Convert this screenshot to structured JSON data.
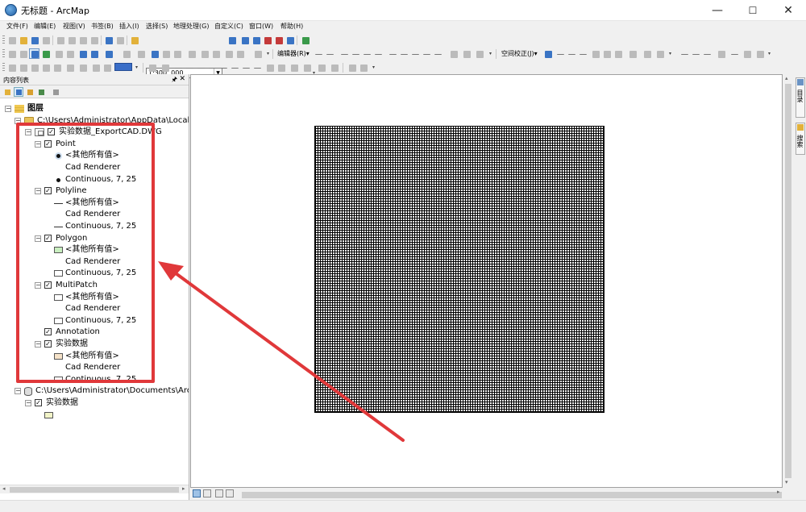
{
  "window": {
    "title": "无标题 - ArcMap",
    "minimize": "—",
    "maximize": "☐",
    "close": "✕"
  },
  "menu": [
    "文件(F)",
    "编辑(E)",
    "视图(V)",
    "书签(B)",
    "插入(I)",
    "选择(S)",
    "地理处理(G)",
    "自定义(C)",
    "窗口(W)",
    "帮助(H)"
  ],
  "toolbar": {
    "scale": "1:300, 000",
    "editor_label": "编辑器(R)▾",
    "spatial_adjust_label": "空间校正(J)▾"
  },
  "toc": {
    "title": "内容列表",
    "pin": "🖈",
    "close": "✕",
    "tree": [
      {
        "level": 0,
        "type": "layers",
        "expander": "⊟",
        "label": "图层"
      },
      {
        "level": 1,
        "type": "folder",
        "expander": "⊟",
        "label": "C:\\Users\\Administrator\\AppData\\Local\\Te"
      },
      {
        "level": 2,
        "type": "group",
        "expander": "⊟",
        "checkbox": true,
        "label": "实验数据_ExportCAD.DWG"
      },
      {
        "level": 3,
        "type": "layer",
        "expander": "⊟",
        "checkbox": true,
        "label": "Point"
      },
      {
        "level": 4,
        "type": "symbol",
        "symbol": "dot-ring",
        "label": "<其他所有值>"
      },
      {
        "level": 4,
        "type": "text",
        "label": "Cad Renderer"
      },
      {
        "level": 4,
        "type": "symbol",
        "symbol": "dot",
        "label": "Continuous, 7, 25"
      },
      {
        "level": 3,
        "type": "layer",
        "expander": "⊟",
        "checkbox": true,
        "label": "Polyline"
      },
      {
        "level": 4,
        "type": "symbol",
        "symbol": "line",
        "label": "<其他所有值>"
      },
      {
        "level": 4,
        "type": "text",
        "label": "Cad Renderer"
      },
      {
        "level": 4,
        "type": "symbol",
        "symbol": "line",
        "label": "Continuous, 7, 25"
      },
      {
        "level": 3,
        "type": "layer",
        "expander": "⊟",
        "checkbox": true,
        "label": "Polygon"
      },
      {
        "level": 4,
        "type": "symbol",
        "symbol": "rect-green",
        "label": "<其他所有值>"
      },
      {
        "level": 4,
        "type": "text",
        "label": "Cad Renderer"
      },
      {
        "level": 4,
        "type": "symbol",
        "symbol": "rect",
        "label": "Continuous, 7, 25"
      },
      {
        "level": 3,
        "type": "layer",
        "expander": "⊟",
        "checkbox": true,
        "label": "MultiPatch"
      },
      {
        "level": 4,
        "type": "symbol",
        "symbol": "rect",
        "label": "<其他所有值>"
      },
      {
        "level": 4,
        "type": "text",
        "label": "Cad Renderer"
      },
      {
        "level": 4,
        "type": "symbol",
        "symbol": "rect",
        "label": "Continuous, 7, 25"
      },
      {
        "level": 3,
        "type": "layer",
        "checkbox": true,
        "label": "Annotation"
      },
      {
        "level": 3,
        "type": "layer",
        "expander": "⊟",
        "checkbox": true,
        "label": "实验数据"
      },
      {
        "level": 4,
        "type": "symbol",
        "symbol": "rect-tan",
        "label": "<其他所有值>"
      },
      {
        "level": 4,
        "type": "text",
        "label": "Cad Renderer"
      },
      {
        "level": 4,
        "type": "symbol",
        "symbol": "rect",
        "label": "Continuous, 7, 25"
      },
      {
        "level": 1,
        "type": "db",
        "expander": "⊟",
        "label": "C:\\Users\\Administrator\\Documents\\ArcG"
      },
      {
        "level": 2,
        "type": "layer",
        "expander": "⊟",
        "checkbox": true,
        "label": "实验数据"
      },
      {
        "level": 3,
        "type": "symbol",
        "symbol": "rect-ltgreen",
        "label": ""
      }
    ]
  },
  "dock": {
    "tabs": [
      "目录",
      "搜索"
    ]
  },
  "colors": {
    "annotation_red": "#e0383a"
  }
}
